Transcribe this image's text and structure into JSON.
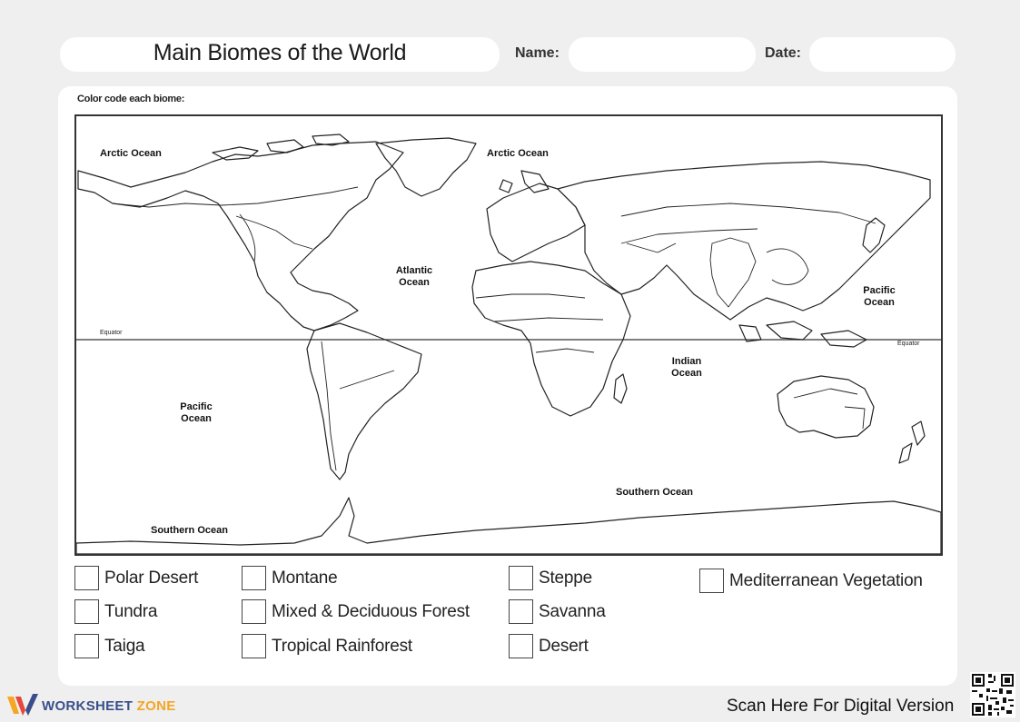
{
  "header": {
    "title": "Main Biomes of the World",
    "name_label": "Name:",
    "date_label": "Date:"
  },
  "instruction": "Color code each biome:",
  "map": {
    "oceans": {
      "arctic_left": "Arctic Ocean",
      "arctic_right": "Arctic Ocean",
      "atlantic": "Atlantic Ocean",
      "pacific_right": "Pacific Ocean",
      "pacific_left": "Pacific Ocean",
      "indian": "Indian Ocean",
      "southern_center": "Southern Ocean",
      "southern_left": "Southern Ocean"
    },
    "equator_left": "Equator",
    "equator_right": "Equator"
  },
  "legend": {
    "polar_desert": "Polar Desert",
    "tundra": "Tundra",
    "taiga": "Taiga",
    "montane": "Montane",
    "mixed_deciduous": "Mixed & Deciduous Forest",
    "tropical_rainforest": "Tropical Rainforest",
    "steppe": "Steppe",
    "savanna": "Savanna",
    "desert": "Desert",
    "mediterranean": "Mediterranean Vegetation"
  },
  "footer": {
    "brand_main": "WORKSHEET",
    "brand_accent": "ZONE",
    "scan_text": "Scan Here For Digital Version"
  },
  "colors": {
    "brand_blue": "#3a4f8a",
    "brand_orange": "#f5a623"
  }
}
